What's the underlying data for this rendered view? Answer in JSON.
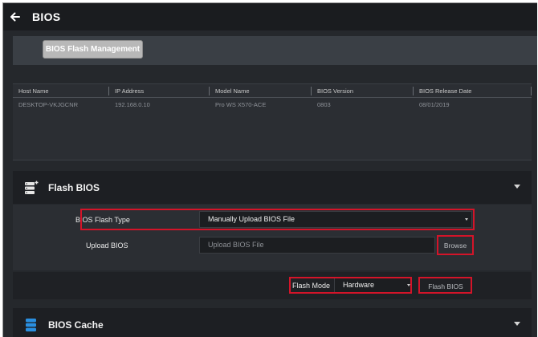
{
  "topbar": {
    "title": "BIOS",
    "back_icon": "arrow-left-icon"
  },
  "tabs": [
    {
      "label": "BIOS Flash Management",
      "selected": true
    }
  ],
  "info_table": {
    "columns": [
      "Host Name",
      "IP Address",
      "Model Name",
      "BIOS Version",
      "BIOS Release Date"
    ],
    "rows": [
      [
        "DESKTOP-VKJGCNR",
        "192.168.0.10",
        "Pro WS X570-ACE",
        "0803",
        "08/01/2019"
      ]
    ]
  },
  "flash_panel": {
    "title": "Flash BIOS",
    "icon": "server-plus-icon",
    "flash_type_label": "BIOS Flash Type",
    "flash_type_value": "Manually Upload BIOS File",
    "upload_label": "Upload BIOS",
    "upload_placeholder": "Upload BIOS File",
    "browse_label": "Browse",
    "flash_mode_label": "Flash Mode",
    "flash_mode_value": "Hardware",
    "flash_button_label": "Flash BIOS"
  },
  "cache_panel": {
    "title": "BIOS Cache",
    "icon": "database-icon"
  },
  "colors": {
    "highlight": "#d41429",
    "panel_header": "#1d1f23",
    "background": "#25282c"
  }
}
